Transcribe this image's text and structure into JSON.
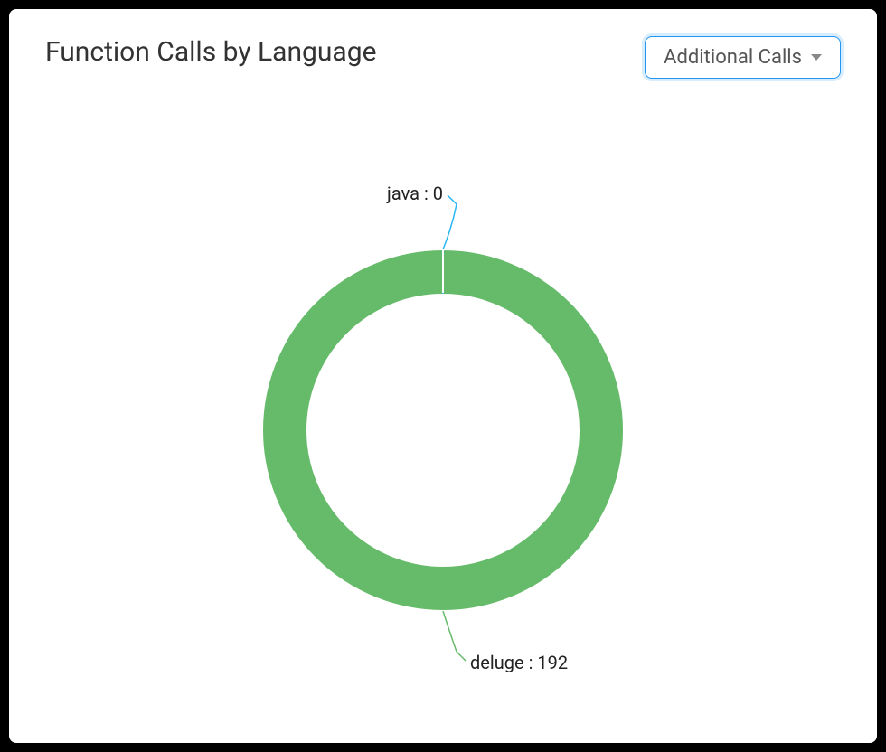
{
  "header": {
    "title": "Function Calls by Language",
    "dropdown_label": "Additional Calls"
  },
  "chart_data": {
    "type": "pie",
    "title": "Function Calls by Language",
    "series": [
      {
        "name": "java",
        "value": 0,
        "color": "#29b6f6"
      },
      {
        "name": "deluge",
        "value": 192,
        "color": "#66bb6a"
      }
    ],
    "labels": {
      "java": "java : 0",
      "deluge": "deluge : 192"
    },
    "donut": true,
    "inner_radius_ratio": 0.78
  }
}
